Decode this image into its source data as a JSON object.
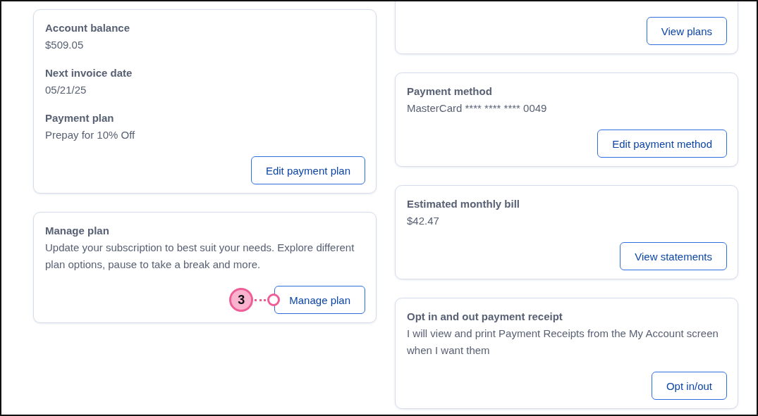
{
  "left_cards": [
    {
      "fields": [
        {
          "label": "Account balance",
          "value": "$509.05"
        },
        {
          "label": "Next invoice date",
          "value": "05/21/25"
        },
        {
          "label": "Payment plan",
          "value": "Prepay for 10% Off"
        }
      ],
      "button": "Edit payment plan"
    },
    {
      "fields": [
        {
          "label": "Manage plan",
          "value": "Update your subscription to best suit your needs. Explore different plan options, pause to take a break and more."
        }
      ],
      "button": "Manage plan",
      "callout": "3"
    }
  ],
  "right_cards": [
    {
      "button": "View plans"
    },
    {
      "fields": [
        {
          "label": "Payment method",
          "value": "MasterCard **** **** **** 0049"
        }
      ],
      "button": "Edit payment method"
    },
    {
      "fields": [
        {
          "label": "Estimated monthly bill",
          "value": "$42.47"
        }
      ],
      "button": "View statements"
    },
    {
      "fields": [
        {
          "label": "Opt in and out payment receipt",
          "value": "I will view and print Payment Receipts from the My Account screen when I want them"
        }
      ],
      "button": "Opt in/out"
    }
  ]
}
